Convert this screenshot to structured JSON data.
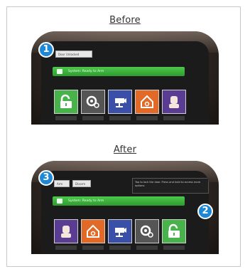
{
  "captions": {
    "before": "Before",
    "after": "After"
  },
  "badges": {
    "one": "1",
    "two": "2",
    "three": "3"
  },
  "before": {
    "tabs": [
      "Door Unlocked"
    ],
    "status_bar": "System: Ready to Arm",
    "tiles": [
      {
        "icon": "unlock-icon",
        "color": "#48b34a"
      },
      {
        "icon": "camera-dial-icon",
        "color": "#555555"
      },
      {
        "icon": "security-camera-icon",
        "color": "#3a4fa8"
      },
      {
        "icon": "home-icon",
        "color": "#e26a26"
      },
      {
        "icon": "user-icon",
        "color": "#5a3d93"
      }
    ]
  },
  "after": {
    "tabs": [
      "Arm",
      "Disarm"
    ],
    "status_bar": "System: Ready to Arm",
    "tooltip": "Tap to lock the door. Press and hold to access more options.",
    "tiles": [
      {
        "icon": "user-icon",
        "color": "#5a3d93"
      },
      {
        "icon": "home-icon",
        "color": "#e26a26"
      },
      {
        "icon": "security-camera-icon",
        "color": "#3a4fa8"
      },
      {
        "icon": "camera-dial-icon",
        "color": "#555555"
      },
      {
        "icon": "unlock-icon",
        "color": "#48b34a"
      }
    ]
  }
}
